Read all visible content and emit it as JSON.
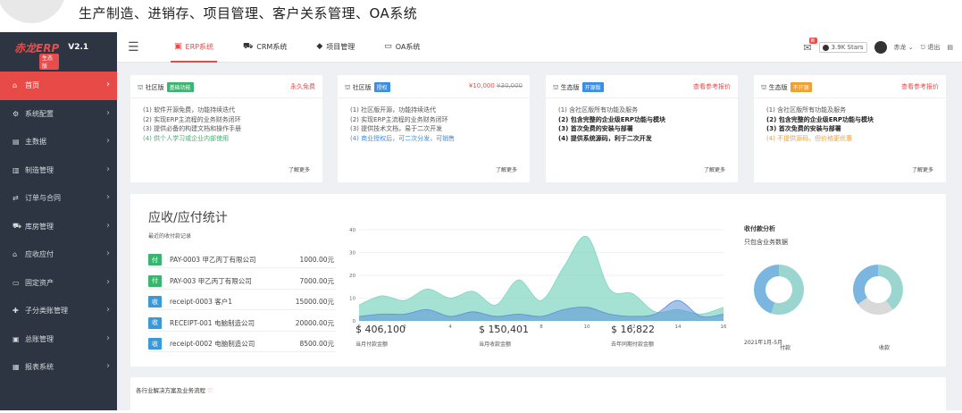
{
  "banner": {
    "headline": "生产制造、进销存、项目管理、客户关系管理、OA系统"
  },
  "brand": {
    "name": "赤龙ERP",
    "edition": "生态版",
    "version": "V2.1"
  },
  "sidebar": {
    "items": [
      {
        "label": "首页",
        "icon": "home-icon"
      },
      {
        "label": "系统配置",
        "icon": "gear-icon"
      },
      {
        "label": "主数据",
        "icon": "database-icon"
      },
      {
        "label": "制造管理",
        "icon": "bar-chart-icon"
      },
      {
        "label": "订单与合同",
        "icon": "handshake-icon"
      },
      {
        "label": "库房管理",
        "icon": "truck-icon"
      },
      {
        "label": "应收应付",
        "icon": "bank-icon"
      },
      {
        "label": "固定资产",
        "icon": "monitor-icon"
      },
      {
        "label": "子分类账管理",
        "icon": "puzzle-icon"
      },
      {
        "label": "总账管理",
        "icon": "book-icon"
      },
      {
        "label": "报表系统",
        "icon": "report-icon"
      }
    ]
  },
  "topbar": {
    "tabs": [
      {
        "label": "ERP系统",
        "icon": "erp-icon"
      },
      {
        "label": "CRM系统",
        "icon": "truck-icon"
      },
      {
        "label": "项目管理",
        "icon": "cube-icon"
      },
      {
        "label": "OA系统",
        "icon": "laptop-icon"
      }
    ],
    "stars": "3.9K Stars",
    "user": "赤龙",
    "logout": "退出"
  },
  "plans": [
    {
      "edition": "社区版",
      "tag": "基础功能",
      "tag_color": "#3bb46f",
      "price": "永久免费",
      "price_old": "",
      "items": [
        "(1) 软件开源免费，功能持续迭代",
        "(2) 实现ERP主流程的业务财务闭环",
        "(3) 提供必备的构建文档和操作手册",
        "(4) 供个人学习或企业内部使用"
      ],
      "item_colors": [
        "#555",
        "#555",
        "#555",
        "#3bb46f"
      ],
      "item_bold": [
        false,
        false,
        false,
        false
      ],
      "more": "了解更多"
    },
    {
      "edition": "社区版",
      "tag": "授权",
      "tag_color": "#3a8ee6",
      "price": "¥10,000",
      "price_old": "¥30,000",
      "items": [
        "(1) 社区版开源，功能持续迭代",
        "(2) 实现ERP主流程的业务财务闭环",
        "(3) 提供技术文档，易于二次开发",
        "(4) 商业授权后，可二次分发，可销售"
      ],
      "item_colors": [
        "#555",
        "#555",
        "#555",
        "#3a8ee6"
      ],
      "item_bold": [
        false,
        false,
        false,
        false
      ],
      "more": "了解更多"
    },
    {
      "edition": "生态版",
      "tag": "开源版",
      "tag_color": "#3a8ee6",
      "price": "查看参考报价",
      "price_old": "",
      "items": [
        "(1) 含社区版所有功能及服务",
        "(2) 包含完整的企业级ERP功能与模块",
        "(3) 首次免费的安装与部署",
        "(4) 提供系统源码，利于二次开发"
      ],
      "item_colors": [
        "#555",
        "#222",
        "#222",
        "#222"
      ],
      "item_bold": [
        false,
        true,
        true,
        true
      ],
      "more": "了解更多"
    },
    {
      "edition": "生态版",
      "tag": "不开源",
      "tag_color": "#f0a030",
      "price": "查看参考报价",
      "price_old": "",
      "items": [
        "(1) 含社区版所有功能及服务",
        "(2) 包含完整的企业级ERP功能与模块",
        "(3) 首次免费的安装与部署",
        "(4) 不提供源码，但价格更优惠"
      ],
      "item_colors": [
        "#555",
        "#222",
        "#222",
        "#f0a030"
      ],
      "item_bold": [
        false,
        true,
        true,
        false
      ],
      "more": "了解更多"
    }
  ],
  "stats": {
    "title": "应收/应付统计",
    "subtitle": "最近的收付款记录",
    "records": [
      {
        "type": "付",
        "color": "#3bb46f",
        "name": "PAY-0003 甲乙丙丁有限公司",
        "amount": "1000.00元"
      },
      {
        "type": "付",
        "color": "#3bb46f",
        "name": "PAY-003 甲乙丙丁有限公司",
        "amount": "7000.00元"
      },
      {
        "type": "收",
        "color": "#3a9ad9",
        "name": "receipt-0003 客户1",
        "amount": "15000.00元"
      },
      {
        "type": "收",
        "color": "#3a9ad9",
        "name": "RECEIPT-001 电脑制造公司",
        "amount": "20000.00元"
      },
      {
        "type": "收",
        "color": "#3a9ad9",
        "name": "receipt-0002 电脑制造公司",
        "amount": "8500.00元"
      }
    ],
    "summaries": [
      {
        "value": "$ 406,100",
        "label": "当月付款金额"
      },
      {
        "value": "$ 150,401",
        "label": "当月收款金额"
      },
      {
        "value": "$ 16,822",
        "label": "去年同期付款金额"
      }
    ],
    "pie_title": "收付款分析",
    "pie_subtitle": "只包含业务数据",
    "pie_labels": [
      "付款",
      "收款"
    ],
    "pie_date": "2021年1月-5月"
  },
  "chart_data": {
    "type": "area",
    "x": [
      0,
      1,
      2,
      3,
      4,
      5,
      6,
      7,
      8,
      9,
      10,
      11,
      12,
      13,
      14,
      15,
      16
    ],
    "xticks": [
      0,
      2,
      4,
      6,
      8,
      10,
      12,
      14,
      16
    ],
    "yticks": [
      0,
      10,
      20,
      30,
      40
    ],
    "ylim": [
      0,
      40
    ],
    "series": [
      {
        "color": "#7fd6c2",
        "values": [
          7,
          11,
          9,
          14,
          10,
          13,
          7,
          18,
          9,
          24,
          37,
          14,
          12,
          4,
          5,
          3,
          6
        ]
      },
      {
        "color": "#5b8fd6",
        "values": [
          2,
          3,
          3,
          5,
          2,
          4,
          2,
          3,
          2,
          5,
          6,
          3,
          2,
          3,
          9,
          2,
          3
        ]
      }
    ]
  },
  "pie_data": [
    {
      "values": [
        55,
        45
      ],
      "colors": [
        "#9ad6cf",
        "#7ab6e0"
      ]
    },
    {
      "values": [
        40,
        25,
        35
      ],
      "colors": [
        "#9ad6cf",
        "#d9d9d9",
        "#7ab6e0"
      ]
    }
  ],
  "solutions": {
    "title": "各行业解决方案及业务流程"
  }
}
